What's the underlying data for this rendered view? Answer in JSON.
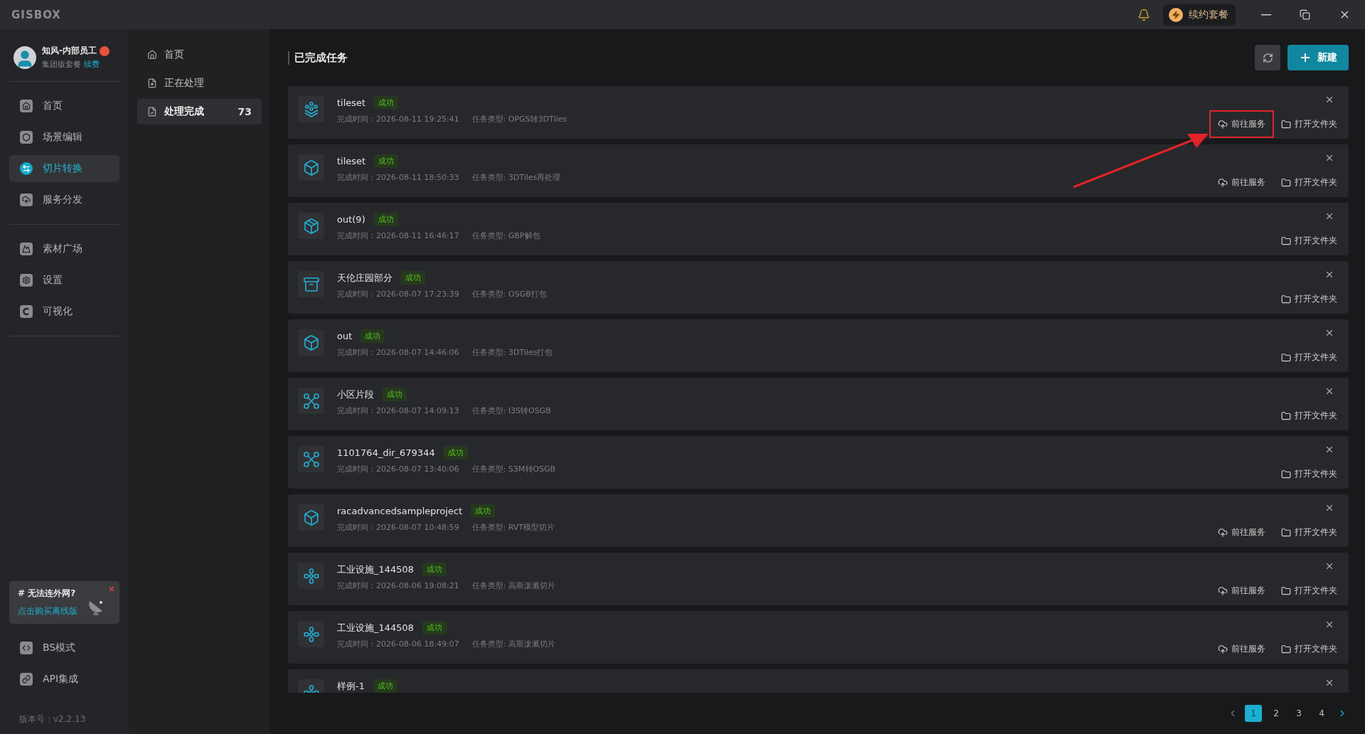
{
  "app": {
    "logo": "GISBOX",
    "renew_label": "续约套餐"
  },
  "user": {
    "name": "知风-内部员工",
    "plan": "集团版套餐",
    "renew_link": "续费"
  },
  "nav_groups": [
    [
      {
        "label": "首页",
        "selected": false
      },
      {
        "label": "场景编辑",
        "selected": false
      },
      {
        "label": "切片转换",
        "selected": true
      },
      {
        "label": "服务分发",
        "selected": false
      }
    ],
    [
      {
        "label": "素材广场",
        "selected": false
      },
      {
        "label": "设置",
        "selected": false
      },
      {
        "label": "可视化",
        "selected": false
      }
    ]
  ],
  "promo": {
    "title": "# 无法连外网?",
    "link": "点击购买离线版"
  },
  "bottom_nav": [
    {
      "label": "BS模式"
    },
    {
      "label": "API集成"
    }
  ],
  "version": "版本号：v2.2.13",
  "sub_nav": [
    {
      "label": "首页",
      "selected": false
    },
    {
      "label": "正在处理",
      "selected": false
    },
    {
      "label": "处理完成",
      "count": "73",
      "selected": true
    }
  ],
  "page": {
    "title": "已完成任务",
    "new_button": "新建"
  },
  "tasks": [
    {
      "name": "tileset",
      "status": "成功",
      "time": "完成时间：2026-08-11 19:25:41",
      "type": "任务类型: OPGS转3DTiles",
      "actions": [
        {
          "kind": "service",
          "label": "前往服务",
          "highlighted": true
        },
        {
          "kind": "folder",
          "label": "打开文件夹",
          "highlighted": false
        }
      ]
    },
    {
      "name": "tileset",
      "status": "成功",
      "time": "完成时间：2026-08-11 18:50:33",
      "type": "任务类型: 3DTiles再处理",
      "actions": [
        {
          "kind": "service",
          "label": "前往服务",
          "highlighted": false
        },
        {
          "kind": "folder",
          "label": "打开文件夹",
          "highlighted": false
        }
      ]
    },
    {
      "name": "out(9)",
      "status": "成功",
      "time": "完成时间：2026-08-11 16:46:17",
      "type": "任务类型: GBP解包",
      "actions": [
        {
          "kind": "folder",
          "label": "打开文件夹",
          "highlighted": false
        }
      ]
    },
    {
      "name": "天伦庄园部分",
      "status": "成功",
      "time": "完成时间：2026-08-07 17:23:39",
      "type": "任务类型: OSGB打包",
      "actions": [
        {
          "kind": "folder",
          "label": "打开文件夹",
          "highlighted": false
        }
      ]
    },
    {
      "name": "out",
      "status": "成功",
      "time": "完成时间：2026-08-07 14:46:06",
      "type": "任务类型: 3DTiles打包",
      "actions": [
        {
          "kind": "folder",
          "label": "打开文件夹",
          "highlighted": false
        }
      ]
    },
    {
      "name": "小区片段",
      "status": "成功",
      "time": "完成时间：2026-08-07 14:09:13",
      "type": "任务类型: I3S转OSGB",
      "actions": [
        {
          "kind": "folder",
          "label": "打开文件夹",
          "highlighted": false
        }
      ]
    },
    {
      "name": "1101764_dir_679344",
      "status": "成功",
      "time": "完成时间：2026-08-07 13:40:06",
      "type": "任务类型: S3M转OSGB",
      "actions": [
        {
          "kind": "folder",
          "label": "打开文件夹",
          "highlighted": false
        }
      ]
    },
    {
      "name": "racadvancedsampleproject",
      "status": "成功",
      "time": "完成时间：2026-08-07 10:48:59",
      "type": "任务类型: RVT模型切片",
      "actions": [
        {
          "kind": "service",
          "label": "前往服务",
          "highlighted": false
        },
        {
          "kind": "folder",
          "label": "打开文件夹",
          "highlighted": false
        }
      ]
    },
    {
      "name": "工业设施_144508",
      "status": "成功",
      "time": "完成时间：2026-08-06 19:08:21",
      "type": "任务类型: 高斯泼溅切片",
      "actions": [
        {
          "kind": "service",
          "label": "前往服务",
          "highlighted": false
        },
        {
          "kind": "folder",
          "label": "打开文件夹",
          "highlighted": false
        }
      ]
    },
    {
      "name": "工业设施_144508",
      "status": "成功",
      "time": "完成时间：2026-08-06 18:49:07",
      "type": "任务类型: 高斯泼溅切片",
      "actions": [
        {
          "kind": "service",
          "label": "前往服务",
          "highlighted": false
        },
        {
          "kind": "folder",
          "label": "打开文件夹",
          "highlighted": false
        }
      ]
    },
    {
      "name": "样例-1",
      "status": "成功"
    }
  ],
  "pagination": [
    {
      "label": "1",
      "selected": true
    },
    {
      "label": "2",
      "selected": false
    },
    {
      "label": "3",
      "selected": false
    },
    {
      "label": "4",
      "selected": false
    }
  ]
}
